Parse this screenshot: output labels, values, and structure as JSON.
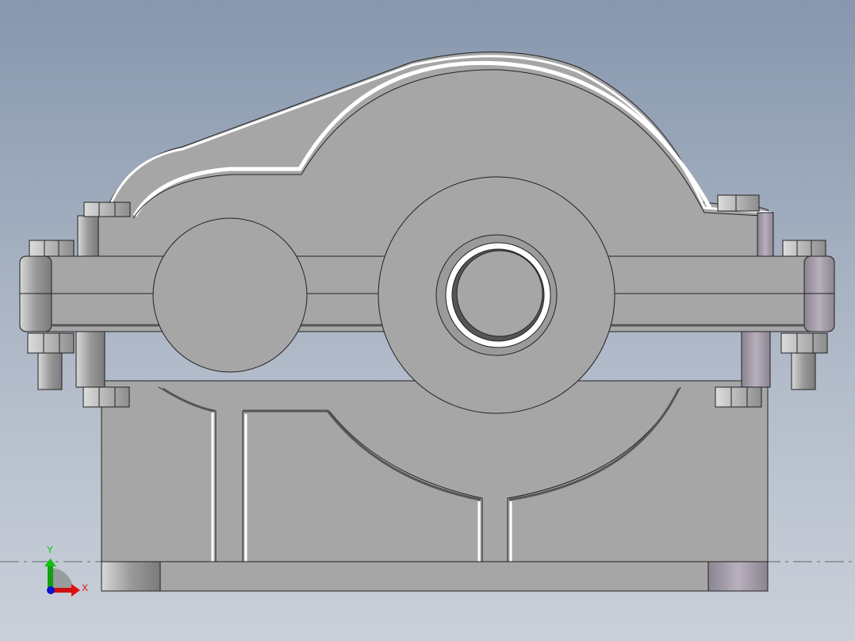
{
  "viewport": {
    "model": "gear-reducer-housing",
    "view": "front"
  },
  "triad": {
    "x_label": "X",
    "y_label": "Y",
    "x_color": "#e01010",
    "y_color": "#10c010",
    "z_color": "#1010d0"
  },
  "colors": {
    "body": "#a6a6a6",
    "edge": "#2a2a2a",
    "highlight": "#ffffff"
  }
}
